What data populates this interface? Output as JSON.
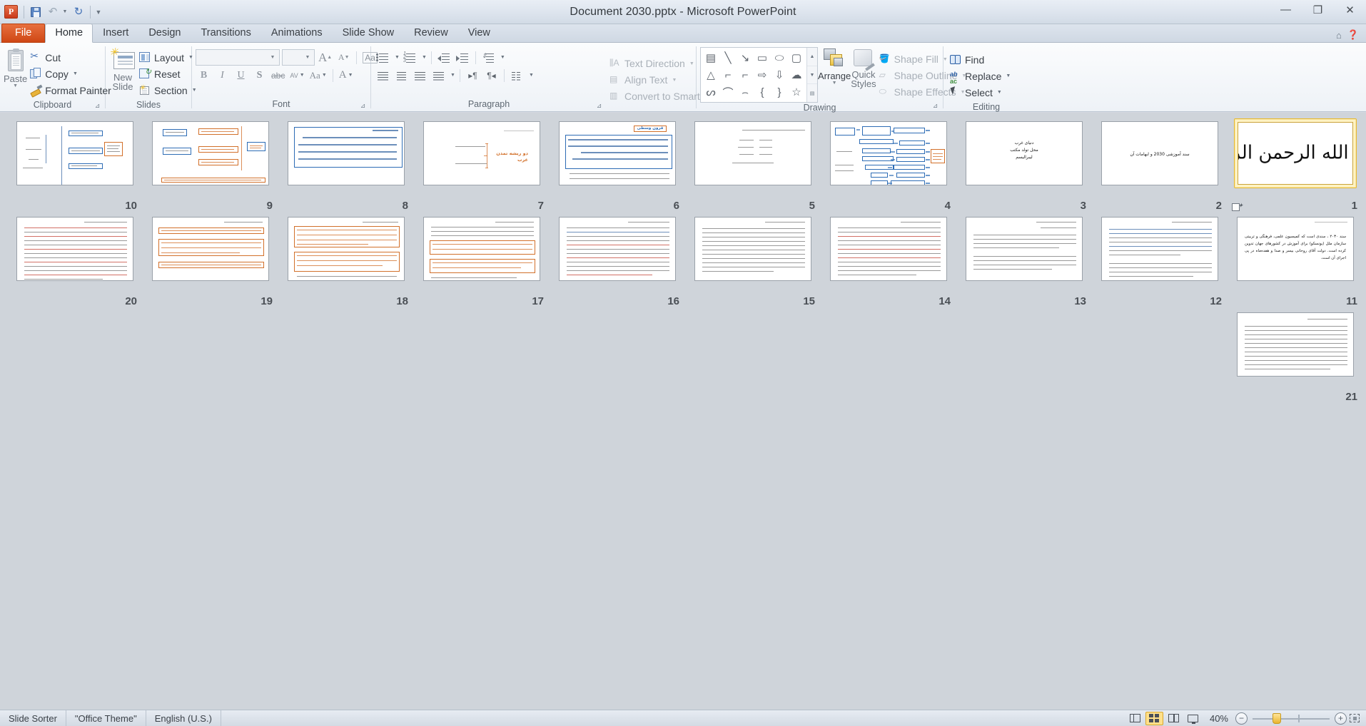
{
  "window": {
    "title": "Document 2030.pptx  -  Microsoft PowerPoint",
    "minimize": "—",
    "restore": "❐",
    "close": "✕"
  },
  "quick_access": {
    "app_logo": "P",
    "save": "save-icon",
    "undo": "undo-icon",
    "redo": "redo-icon",
    "customize": "customize-icon"
  },
  "tabs": [
    {
      "label": "File",
      "active": false,
      "kind": "file"
    },
    {
      "label": "Home",
      "active": true
    },
    {
      "label": "Insert",
      "active": false
    },
    {
      "label": "Design",
      "active": false
    },
    {
      "label": "Transitions",
      "active": false
    },
    {
      "label": "Animations",
      "active": false
    },
    {
      "label": "Slide Show",
      "active": false
    },
    {
      "label": "Review",
      "active": false
    },
    {
      "label": "View",
      "active": false
    }
  ],
  "ribbon": {
    "groups": [
      {
        "label": "Clipboard"
      },
      {
        "label": "Slides"
      },
      {
        "label": "Font"
      },
      {
        "label": "Paragraph"
      },
      {
        "label": "Drawing"
      },
      {
        "label": "Editing"
      }
    ],
    "clipboard": {
      "paste": "Paste",
      "cut": "Cut",
      "copy": "Copy",
      "format_painter": "Format Painter"
    },
    "slides": {
      "new_slide_line1": "New",
      "new_slide_line2": "Slide",
      "layout": "Layout",
      "reset": "Reset",
      "section": "Section"
    },
    "font": {
      "font_name_value": "",
      "font_size_value": "",
      "grow_font": "A",
      "shrink_font": "A",
      "clear_formatting": "Aa",
      "bold": "B",
      "italic": "I",
      "underline": "U",
      "shadow": "S",
      "strikethrough": "abc",
      "character_spacing": "AV",
      "change_case": "Aa",
      "font_color": "A"
    },
    "paragraph": {
      "bullets": "bullets-icon",
      "numbering": "numbering-icon",
      "decrease_indent": "decrease-indent-icon",
      "increase_indent": "increase-indent-icon",
      "line_spacing": "line-spacing-icon",
      "align_left": "align-left-icon",
      "center": "align-center-icon",
      "align_right": "align-right-icon",
      "justify": "justify-icon",
      "ltr": "text-direction-ltr-icon",
      "rtl": "text-direction-rtl-icon",
      "columns": "columns-icon",
      "text_direction": "Text Direction",
      "align_text": "Align Text",
      "convert_to_smartart": "Convert to SmartArt"
    },
    "drawing": {
      "shapes": [
        "text-box-shape",
        "line-shape",
        "arrow-shape",
        "rectangle-shape",
        "oval-shape",
        "rounded-rect-shape",
        "triangle-shape",
        "elbow-connector-shape",
        "elbow-arrow-shape",
        "right-arrow-shape",
        "down-arrow-shape",
        "cloud-shape",
        "freeform-shape",
        "curve-shape",
        "arc-shape",
        "left-brace-shape",
        "right-brace-shape",
        "star-shape"
      ],
      "shape_glyphs": [
        "▤",
        "╲",
        "↘",
        "▭",
        "⬭",
        "▢",
        "△",
        "⌐",
        "⌐",
        "⇨",
        "⇩",
        "☁",
        "ᔕ",
        "⌒",
        "⌢",
        "{",
        "}",
        "☆"
      ],
      "arrange": "Arrange",
      "quick_styles_line1": "Quick",
      "quick_styles_line2": "Styles",
      "shape_fill": "Shape Fill",
      "shape_outline": "Shape Outline",
      "shape_effects": "Shape Effects"
    },
    "editing": {
      "find": "Find",
      "replace": "Replace",
      "select": "Select"
    }
  },
  "slide_sorter": {
    "rows": [
      [
        {
          "number": "10",
          "kind": "diagram-blue",
          "selected": false
        },
        {
          "number": "9",
          "kind": "diagram-boxes",
          "selected": false
        },
        {
          "number": "8",
          "kind": "text-box-blue",
          "selected": false
        },
        {
          "number": "7",
          "kind": "brace-title",
          "selected": false
        },
        {
          "number": "6",
          "kind": "titled-text-box",
          "selected": false
        },
        {
          "number": "5",
          "kind": "sparse-lines",
          "selected": false
        },
        {
          "number": "4",
          "kind": "flowchart",
          "selected": false
        },
        {
          "number": "3",
          "kind": "centered-title",
          "selected": false
        },
        {
          "number": "2",
          "kind": "single-line-title",
          "selected": false
        },
        {
          "number": "1",
          "kind": "bismillah",
          "selected": true,
          "has_transition": true
        }
      ],
      [
        {
          "number": "20",
          "kind": "dense-text",
          "selected": false
        },
        {
          "number": "19",
          "kind": "boxed-paragraphs",
          "selected": false
        },
        {
          "number": "18",
          "kind": "boxed-dense",
          "selected": false
        },
        {
          "number": "17",
          "kind": "boxed-dense2",
          "selected": false
        },
        {
          "number": "16",
          "kind": "dense-text-red",
          "selected": false
        },
        {
          "number": "15",
          "kind": "dense-text",
          "selected": false
        },
        {
          "number": "14",
          "kind": "dense-text-red",
          "selected": false
        },
        {
          "number": "13",
          "kind": "dense-text",
          "selected": false
        },
        {
          "number": "12",
          "kind": "dense-text-blue",
          "selected": false
        },
        {
          "number": "11",
          "kind": "paragraph-center",
          "selected": false
        }
      ],
      [
        {
          "number": "21",
          "kind": "dense-text",
          "selected": false
        }
      ]
    ],
    "slide_texts": {
      "s1_bismillah": "بسم الله الرحمن الرحیم",
      "s2_title": "سند آموزشی 2030  و ابهامات آن",
      "s3_lines": [
        "دنیای غرب",
        "محل تولد مکتب",
        "لیبرالیسم"
      ],
      "s5_header": "مبانی حاکمیت، علوم انسانی در اندیشه غرب با اسلام در:",
      "s6_title": "قرون وسطی",
      "s6_lines": [
        "در دوره قرون وسطی کلیسا بر تمام شئون جامعه حاکم بود.",
        "کلیسا حاکمیتی مطلق تمام برجامعه حاکمیت می‌یافت.",
        "کلیسا از خدا یک تصویر انسانی ساخت.",
        "کلیسا به جای هدایت و سعادت ، بیام آور ظلم شده بود."
      ],
      "s7_title": "دو ریشه تمدن غرب",
      "s8_heading": "دوره ی مدرن:",
      "s8_lines": [
        "دوران مدرن در واقع دوره ی نقد سنت است.",
        "در این دوره، عنصر فربه‌ترشدن یافته و فرد به گونه‌ای",
        "آزاد و پر بنیاد اندیشه ی تفکراتی، خودش را مالک",
        "طبیعت می داند و به مفهوم توسعه ارزش می دهد."
      ],
      "s9_boxes": [
        "اومانیسم",
        "سکولاریسم",
        "فرد گرایی افراطی",
        "جدایی دین از سیاست",
        "بی دقتی به اسطوره - گرایی"
      ],
      "s11_paragraph": "سند ۲۰۳۰ ، سندی است که کمیسیون علمی، فرهنگی و تربیتی سازمان ملل (یونسکو) برای آموزش در کشورهای جهان تدوین کرده است. دولت آقای روحانی بیسر و صدا و هفده‌ماه در پی اجرای آن است."
    }
  },
  "status_bar": {
    "view_name": "Slide Sorter",
    "theme": "\"Office Theme\"",
    "language": "English (U.S.)",
    "zoom_level": "40%",
    "views": [
      {
        "name": "normal-view",
        "label": "Normal",
        "active": false
      },
      {
        "name": "slide-sorter-view",
        "label": "Slide Sorter",
        "active": true
      },
      {
        "name": "reading-view",
        "label": "Reading View",
        "active": false
      },
      {
        "name": "slide-show-view",
        "label": "Slide Show",
        "active": false
      }
    ],
    "zoom_out": "−",
    "zoom_in": "+",
    "fit_to_window": "fit-to-window-icon"
  }
}
